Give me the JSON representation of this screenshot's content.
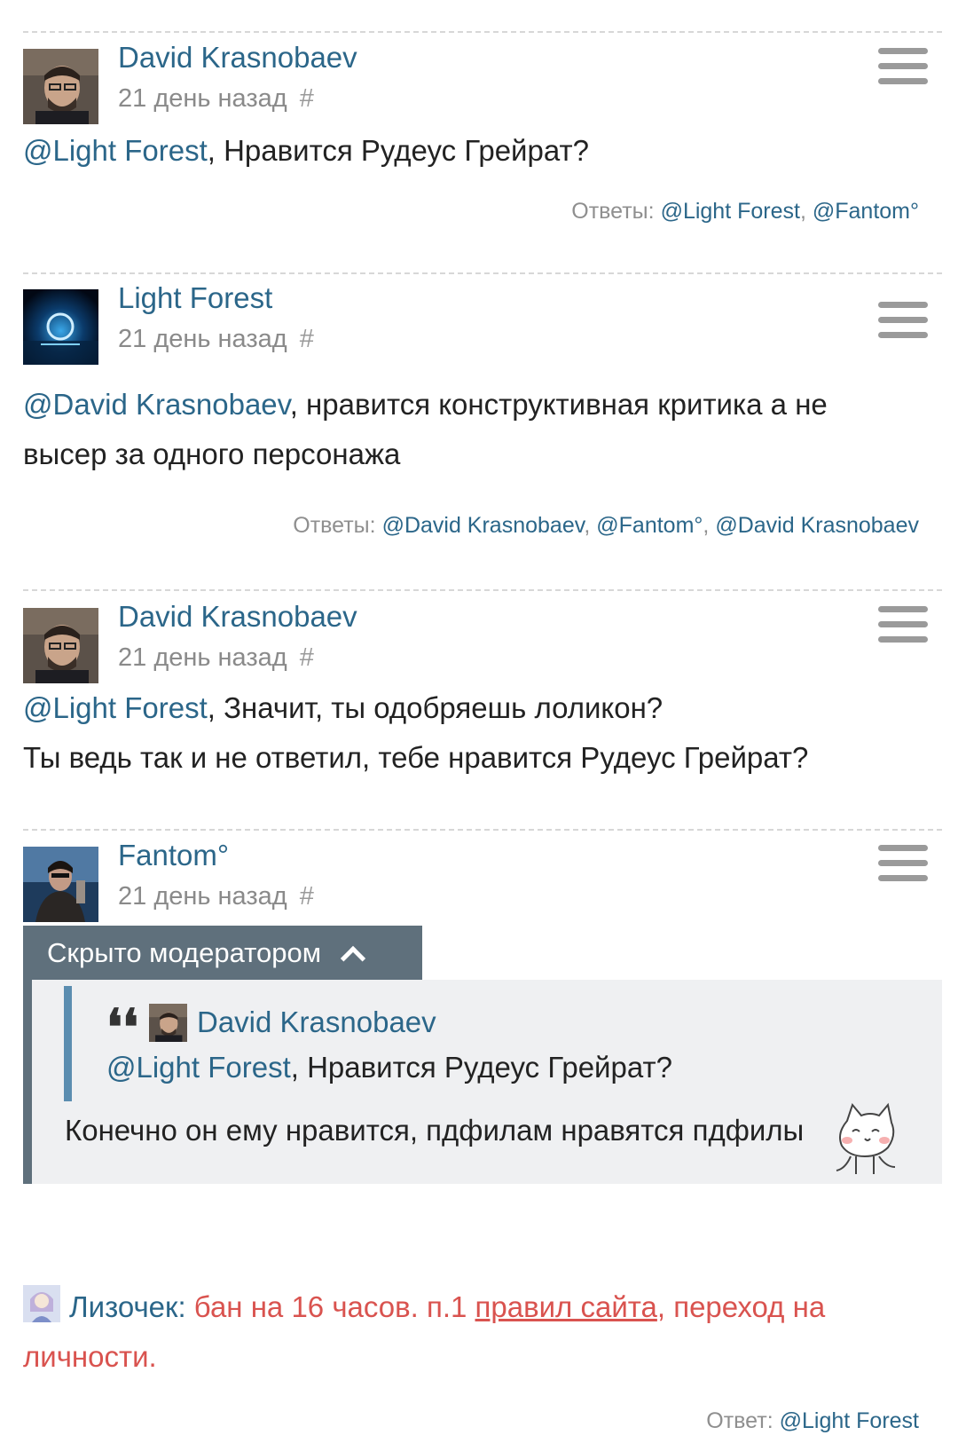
{
  "comments": [
    {
      "author": "David Krasnobaev",
      "time": "21 день назад",
      "hash": "#",
      "mention": "@Light Forest",
      "text_after_mention": ", Нравится Рудеус Грейрат?",
      "replies_label": "Ответы:",
      "replies": [
        "@Light Forest",
        "@Fantom°"
      ]
    },
    {
      "author": "Light Forest",
      "time": "21 день назад",
      "hash": "#",
      "mention": "@David Krasnobaev",
      "text_after_mention": ", нравится конструктивная критика а не высер за одного персонажа",
      "replies_label": "Ответы:",
      "replies": [
        "@David Krasnobaev",
        "@Fantom°",
        "@David Krasnobaev"
      ]
    },
    {
      "author": "David Krasnobaev",
      "time": "21 день назад",
      "hash": "#",
      "mention": "@Light Forest",
      "text_after_mention": ", Значит, ты одобряешь лоликон?",
      "text_line2": "Ты ведь так и не ответил, тебе нравится Рудеус Грейрат?"
    },
    {
      "author": "Fantom°",
      "time": "21 день назад",
      "hash": "#"
    }
  ],
  "hidden": {
    "bar_label": "Скрыто модератором",
    "quote_author": "David Krasnobaev",
    "quote_mention": "@Light Forest",
    "quote_text": ", Нравится Рудеус Грейрат?",
    "text": "Конечно он ему нравится, пдфилам нравятся пдфилы"
  },
  "moderator": {
    "name": "Лизочек",
    "colon": ":",
    "text_before_link": " бан на 16 часов. п.1 ",
    "link_text": "правил сайта",
    "text_after_link": ", переход на личности.",
    "reply_label": "Ответ:",
    "reply_to": "@Light Forest"
  },
  "colors": {
    "link": "#2b6689",
    "moderator_text": "#d9534f",
    "hidden_bar": "#5f707c",
    "quote_border": "#5b8db0"
  },
  "icons": [
    "hash-icon",
    "menu-icon",
    "chevron-up-icon",
    "quote-icon",
    "sticker-icon"
  ]
}
